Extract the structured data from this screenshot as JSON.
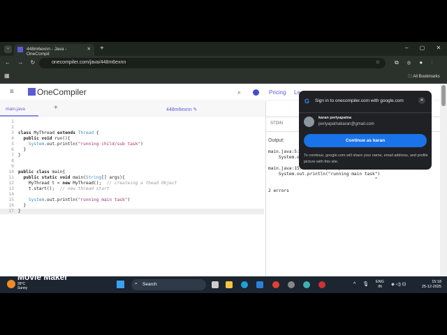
{
  "browser": {
    "tab_title": "448m6exnn - Java - OneCompil",
    "url": "onecompiler.com/java/448m6exnn",
    "bookmarks_label": "All Bookmarks"
  },
  "site": {
    "logo": "OneCompiler",
    "nav": [
      "Pricing",
      "Le"
    ],
    "file_tab": "main.java",
    "project_name": "448m6exnn",
    "stdin_label": "STDIN",
    "output_label": "Output:"
  },
  "code": {
    "lines": [
      [],
      [],
      [
        [
          "kw",
          "class "
        ],
        [
          "",
          "MyThread "
        ],
        [
          "kw",
          "extends "
        ],
        [
          "cl",
          "Thread"
        ],
        [
          "",
          " {"
        ]
      ],
      [
        [
          "kw",
          "  public void "
        ],
        [
          "",
          "run(){"
        ]
      ],
      [
        [
          "cl",
          "    System"
        ],
        [
          "",
          ".out.println("
        ],
        [
          "st",
          "\"running child/sub task\""
        ],
        [
          "",
          ")"
        ]
      ],
      [
        [
          "",
          "  }"
        ]
      ],
      [
        [
          "",
          "}"
        ]
      ],
      [],
      [],
      [
        [
          "kw",
          "public class "
        ],
        [
          "",
          "main{"
        ]
      ],
      [
        [
          "kw",
          "  public static void "
        ],
        [
          "",
          "main("
        ],
        [
          "cl",
          "String"
        ],
        [
          "",
          "[] args){"
        ]
      ],
      [
        [
          "",
          "    MyThread t = "
        ],
        [
          "kw",
          "new "
        ],
        [
          "",
          "MyThread();  "
        ],
        [
          "cm",
          "// createing a thead Object"
        ]
      ],
      [
        [
          "",
          "    t.start();  "
        ],
        [
          "cm",
          "// new thread start"
        ]
      ],
      [],
      [
        [
          "cl",
          "    System"
        ],
        [
          "",
          ".out.println("
        ],
        [
          "st",
          "\"running main task\""
        ],
        [
          "",
          ")"
        ]
      ],
      [
        [
          "",
          "  }"
        ]
      ],
      [
        [
          "",
          "}"
        ]
      ]
    ]
  },
  "output": {
    "text": "main.java:5:\n    System.o\n\nmain.java:15: error: ';' expected\n    System.out.println(\"running main task\")\n                                         ^\n\n2 errors"
  },
  "popup": {
    "title": "Sign in to onecompiler.com with google.com",
    "name": "karan periyapatna",
    "email": "periyapatnakaran@gmail.com",
    "button": "Continue as karan",
    "notice": "To continue, google.com will share your name, email address, and profile picture with this site."
  },
  "taskbar": {
    "weather_temp": "28°C",
    "weather_desc": "Sunny",
    "search": "Search",
    "lang": "ENG",
    "region": "IN",
    "time": "15:18",
    "date": "25-12-2025",
    "watermark_small": "Created with",
    "watermark": "Movie Maker"
  },
  "colors": {
    "accent": "#5b5bd6",
    "google_button": "#1a73e8"
  }
}
